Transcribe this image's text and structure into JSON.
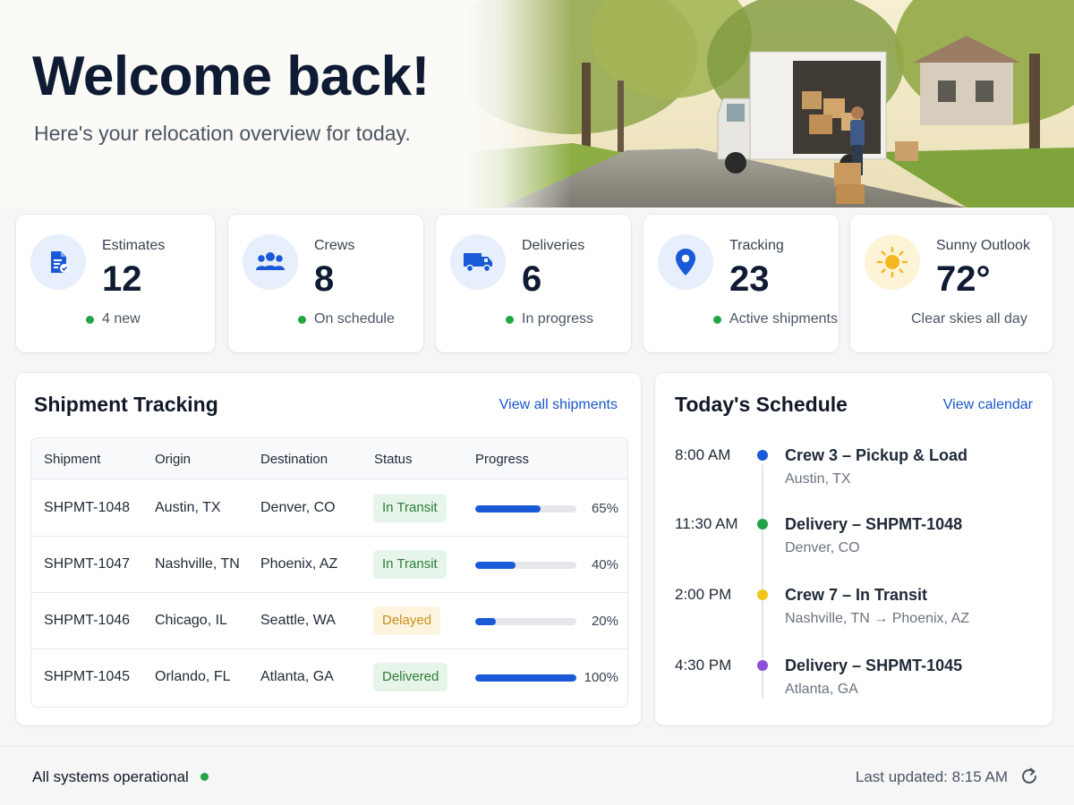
{
  "header": {
    "title": "Welcome back!",
    "subtitle": "Here's your relocation overview for today."
  },
  "stats": [
    {
      "label": "Estimates",
      "value": "12",
      "note": "4 new",
      "icon": "document-check-icon"
    },
    {
      "label": "Crews",
      "value": "8",
      "note": "On schedule",
      "icon": "people-group-icon"
    },
    {
      "label": "Deliveries",
      "value": "6",
      "note": "In progress",
      "icon": "delivery-truck-icon"
    },
    {
      "label": "Tracking",
      "value": "23",
      "note": "Active shipments",
      "icon": "map-pin-icon"
    },
    {
      "label": "Sunny Outlook",
      "value": "72°",
      "note": "Clear skies all day",
      "icon": "sun-icon"
    }
  ],
  "shipments": {
    "title": "Shipment Tracking",
    "link": "View all shipments",
    "columns": [
      "Shipment",
      "Origin",
      "Destination",
      "Status",
      "Progress"
    ],
    "rows": [
      {
        "id": "SHPMT-1048",
        "origin": "Austin, TX",
        "destination": "Denver, CO",
        "status": "In Transit",
        "progress": 65,
        "progress_label": "65%"
      },
      {
        "id": "SHPMT-1047",
        "origin": "Nashville, TN",
        "destination": "Phoenix, AZ",
        "status": "In Transit",
        "progress": 40,
        "progress_label": "40%"
      },
      {
        "id": "SHPMT-1046",
        "origin": "Chicago, IL",
        "destination": "Seattle, WA",
        "status": "Delayed",
        "progress": 20,
        "progress_label": "20%"
      },
      {
        "id": "SHPMT-1045",
        "origin": "Orlando, FL",
        "destination": "Atlanta, GA",
        "status": "Delivered",
        "progress": 100,
        "progress_label": "100%"
      }
    ]
  },
  "schedule": {
    "title": "Today's Schedule",
    "link": "View calendar",
    "items": [
      {
        "time": "8:00 AM",
        "title": "Crew 3 – Pickup & Load",
        "subtitle": "Austin, TX",
        "color": "#1a5ad8"
      },
      {
        "time": "11:30 AM",
        "title": "Delivery – SHPMT-1048",
        "subtitle": "Denver, CO",
        "color": "#22a447"
      },
      {
        "time": "2:00 PM",
        "title": "Crew 7 – In Transit",
        "subtitle": "Nashville, TN → Phoenix, AZ",
        "color": "#f2c318"
      },
      {
        "time": "4:30 PM",
        "title": "Delivery – SHPMT-1045",
        "subtitle": "Atlanta, GA",
        "color": "#8a4fd6"
      }
    ]
  },
  "footer": {
    "status": "All systems operational",
    "last_updated": "Last updated: 8:15 AM"
  },
  "colors": {
    "accent": "#1a5ad8",
    "success": "#22a447",
    "warning": "#c8901a",
    "title": "#0f1b33"
  }
}
